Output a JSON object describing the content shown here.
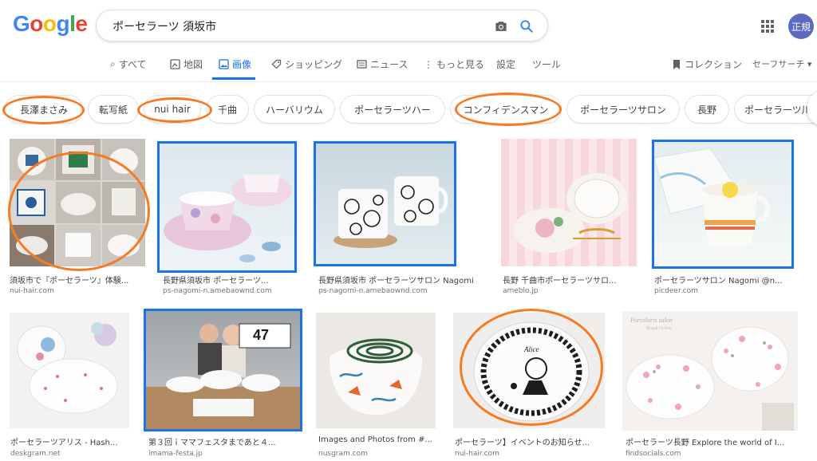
{
  "logo": {
    "text": "Google",
    "letters": [
      "G",
      "o",
      "o",
      "g",
      "l",
      "e"
    ],
    "colors": [
      "#4285f4",
      "#ea4335",
      "#fbbc05",
      "#4285f4",
      "#34a853",
      "#ea4335"
    ]
  },
  "search": {
    "query": "ポーセラーツ 須坂市"
  },
  "avatar": {
    "label": "正規"
  },
  "tabs": [
    {
      "label": "すべて",
      "icon": "search-icon"
    },
    {
      "label": "地図",
      "icon": "map-icon"
    },
    {
      "label": "画像",
      "icon": "image-icon"
    },
    {
      "label": "ショッピング",
      "icon": "tag-icon"
    },
    {
      "label": "ニュース",
      "icon": "news-icon"
    },
    {
      "label": "もっと見る",
      "icon": "more-vert-icon"
    },
    {
      "label": "設定",
      "icon": ""
    },
    {
      "label": "ツール",
      "icon": ""
    }
  ],
  "right_tabs": {
    "collection": "コレクション",
    "safesearch": "セーフサーチ ▾"
  },
  "chips": [
    "長澤まさみ",
    "転写紙",
    "nui hair",
    "千曲",
    "ハーバリウム",
    "ポーセラーツハー",
    "コンフィデンスマン",
    "ポーセラーツサロン",
    "長野",
    "ポーセラーツ川"
  ],
  "results": [
    {
      "caption": "須坂市で『ポーセラーツ』体験...",
      "source": "nui-hair.com"
    },
    {
      "caption": "長野県須坂市 ポーセラーツ...",
      "source": "ps-nagomi-n.amebaownd.com"
    },
    {
      "caption": "長野県須坂市 ポーセラーツサロン Nagomi",
      "source": "ps-nagomi-n.amebaownd.com"
    },
    {
      "caption": "長野 千曲市ポーセラーツサロ...",
      "source": "ameblo.jp"
    },
    {
      "caption": "ポーセラーツサロン Nagomi @n...",
      "source": "picdeer.com"
    },
    {
      "caption": "ポーセラーツアリス - Hash...",
      "source": "deskgram.net"
    },
    {
      "caption": "第３回ｉママフェスタまであと４...",
      "source": "imama-festa.jp"
    },
    {
      "caption": "Images and Photos from #...",
      "source": "nusgram.com"
    },
    {
      "caption": "ポーセラーツ】イベントのお知らせ...",
      "source": "nui-hair.com"
    },
    {
      "caption": "ポーセラーツ長野 Explore the world of I...",
      "source": "findsocials.com"
    }
  ],
  "image_text": {
    "sign_digits": "47",
    "plate_word": "Alice",
    "watermark": "Porcelarts salon",
    "watermark2": "Royal Ochou"
  },
  "colors": {
    "accent": "#1a73e8",
    "annotation_blue": "#1a73e8",
    "annotation_orange": "#f57c24"
  }
}
